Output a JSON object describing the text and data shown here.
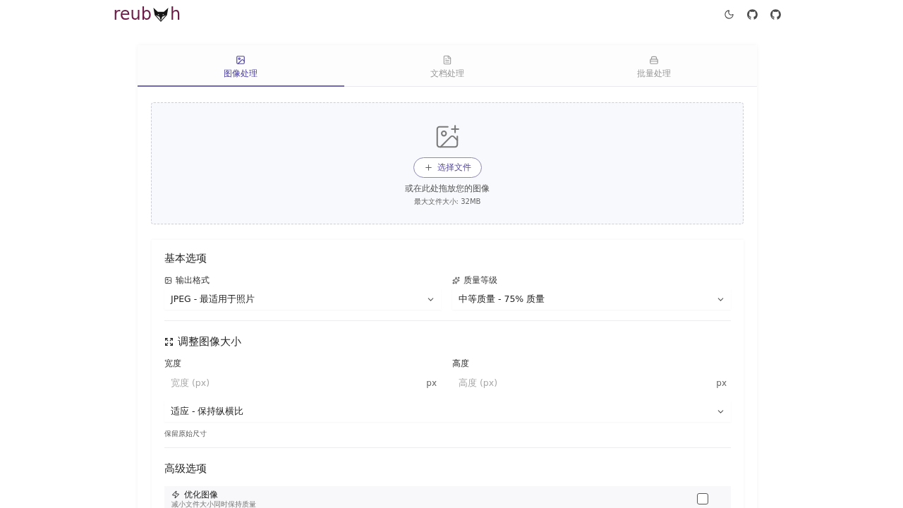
{
  "logo": {
    "before": "reub",
    "after": "h"
  },
  "tabs": [
    {
      "label": "图像处理",
      "kind": "image",
      "selected": true
    },
    {
      "label": "文档处理",
      "kind": "document",
      "selected": false
    },
    {
      "label": "批量处理",
      "kind": "batch",
      "selected": false
    }
  ],
  "upload": {
    "button": "选择文件",
    "hint": "或在此处拖放您的图像",
    "limit": "最大文件大小: 32MB"
  },
  "basic_options": {
    "title": "基本选项",
    "fields": [
      {
        "label": "输出格式",
        "kind": "format",
        "value": "JPEG - 最适用于照片"
      },
      {
        "label": "质量等级",
        "kind": "quality",
        "value": "中等质量 - 75% 质量"
      }
    ]
  },
  "resize": {
    "title": "调整图像大小",
    "width": {
      "label": "宽度",
      "placeholder": "宽度 (px)",
      "unit": "px"
    },
    "height": {
      "label": "高度",
      "placeholder": "高度 (px)",
      "unit": "px"
    },
    "mode": {
      "value": "适应 - 保持纵横比"
    },
    "hint": "保留原始尺寸"
  },
  "advanced": {
    "title": "高级选项",
    "options": [
      {
        "label": "优化图像",
        "description": "减小文件大小同时保持质量",
        "checked": false
      }
    ]
  }
}
